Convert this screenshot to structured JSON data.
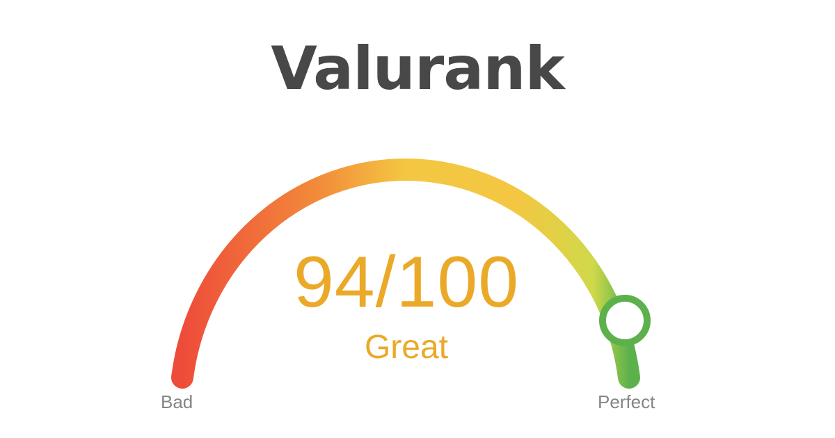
{
  "brand": {
    "name": "Valurank"
  },
  "gauge": {
    "score": 94,
    "max": 100,
    "score_text": "94/100",
    "rating": "Great",
    "min_label": "Bad",
    "max_label": "Perfect",
    "colors": {
      "red": "#ee4c3a",
      "orange": "#f28a3a",
      "yellow": "#f4c742",
      "lime": "#cfd94a",
      "green": "#5db14c",
      "score_text": "#eaa928",
      "label_text": "#858585",
      "title_text": "#484848"
    }
  }
}
